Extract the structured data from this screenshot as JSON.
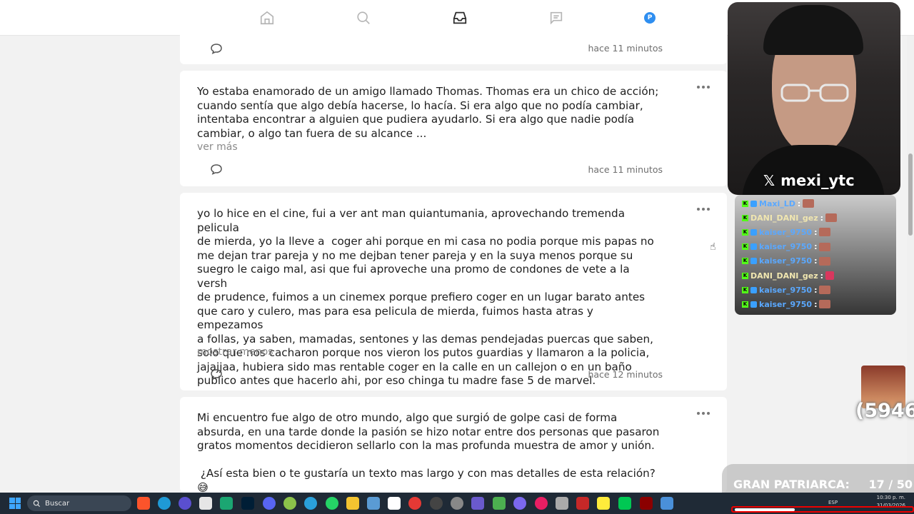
{
  "nav": {
    "items": [
      "home-icon",
      "search-icon",
      "inbox-icon",
      "messages-icon",
      "profile-avatar"
    ],
    "avatar_letter": "P"
  },
  "posts": [
    {
      "time": "hace 11 minutos"
    },
    {
      "text": "Yo estaba enamorado de un amigo llamado Thomas. Thomas era un chico de acción;\ncuando sentía que algo debía hacerse, lo hacía. Si era algo que no podía cambiar,\nintentaba encontrar a alguien que pudiera ayudarlo. Si era algo que nadie podía\ncambiar, o algo tan fuera de su alcance ...",
      "toggle": "ver más",
      "time": "hace 11 minutos"
    },
    {
      "text": "yo lo hice en el cine, fui a ver ant man quiantumania, aprovechando tremenda pelicula\nde mierda, yo la lleve a  coger ahi porque en mi casa no podia porque mis papas no\nme dejan trar pareja y no me dejban tener pareja y en la suya menos porque su\nsuegro le caigo mal, asi que fui aproveche una promo de condones de vete a la versh\nde prudence, fuimos a un cinemex porque prefiero coger en un lugar barato antes\nque caro y culero, mas para esa pelicula de mierda, fuimos hasta atras y empezamos\na follas, ya saben, mamadas, sentones y las demas pendejadas puercas que saben,\nsolo que nos cacharon porque nos vieron los putos guardias y llamaron a la policia,\njajajjaa, hubiera sido mas rentable coger en la calle en un callejon o en un baño\npublico antes que hacerlo ahi, por eso chinga tu madre fase 5 de marvel.",
      "toggle": "mostrar menos",
      "time": "hace 12 minutos"
    },
    {
      "text": "Mi encuentro fue algo de otro mundo, algo que surgió de golpe casi de forma\nabsurda, en una tarde donde la pasión se hizo notar entre dos personas que pasaron\ngratos momentos decidieron sellarlo con la mas profunda muestra de amor y unión.\n\n ¿Así esta bien o te gustaría un texto mas largo y con mas detalles de esta relación?\n😅"
    }
  ],
  "stream": {
    "handle": "mexi_ytc",
    "x_logo": "𝕏",
    "chat": [
      {
        "user": "Maxi_LD",
        "sep": ":",
        "style": "blue"
      },
      {
        "user": "DANI_DANI_gez",
        "sep": ":",
        "style": "gold"
      },
      {
        "user": "kaiser_9750",
        "sep": ":",
        "style": "blue"
      },
      {
        "user": "kaiser_9750",
        "sep": ":",
        "style": "blue"
      },
      {
        "user": "kaiser_9750",
        "sep": ":",
        "style": "blue"
      },
      {
        "user": "DANI_DANI_gez",
        "sep": ":",
        "style": "gold"
      },
      {
        "user": "kaiser_9750",
        "sep": ":",
        "style": "blue"
      },
      {
        "user": "kaiser_9750",
        "sep": ":",
        "style": "blue"
      }
    ],
    "sticker_number": "(5946",
    "goal_label": "GRAN PATRIARCA:",
    "goal_count": "17 / 50"
  },
  "taskbar": {
    "search_placeholder": "Buscar",
    "time": "10:30 p. m.",
    "date": "31/03/2026",
    "lang": "ESP"
  },
  "colors": {
    "accent_blue": "#2e8ef0",
    "kick_green": "#53fc18",
    "taskbar_bg": "#1f2a36"
  }
}
